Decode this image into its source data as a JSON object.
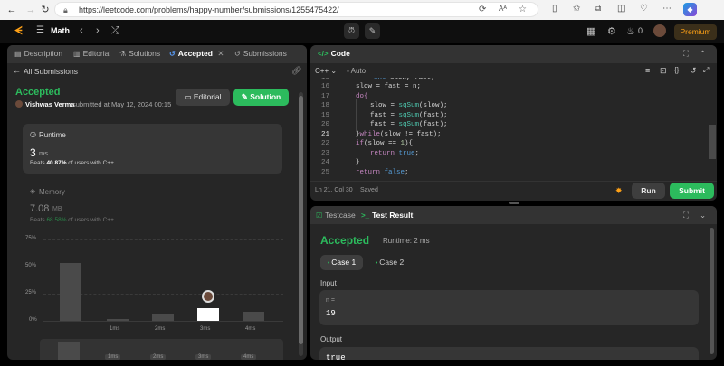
{
  "browser": {
    "url": "https://leetcode.com/problems/happy-number/submissions/1255475422/"
  },
  "topbar": {
    "problem_list": "Math",
    "points": "0",
    "premium": "Premium"
  },
  "left": {
    "tabs": [
      "Description",
      "Editorial",
      "Solutions",
      "Accepted",
      "Submissions"
    ],
    "all_submissions": "All Submissions",
    "status": "Accepted",
    "author": "Vishwas Verma",
    "submitted_text": "submitted at May 12, 2024 00:15",
    "editorial_btn": "Editorial",
    "solution_btn": "Solution",
    "runtime": {
      "label": "Runtime",
      "value": "3",
      "unit": "ms",
      "beats_prefix": "Beats",
      "beats_pct": "40.87%",
      "beats_suffix": "of users with C++"
    },
    "memory": {
      "label": "Memory",
      "value": "7.08",
      "unit": "MB",
      "beats_prefix": "Beats",
      "beats_pct": "68.58%",
      "beats_suffix": "of users with C++"
    },
    "chart": {
      "y_ticks": [
        "75%",
        "50%",
        "25%",
        "0%"
      ],
      "x_ticks": [
        "1ms",
        "2ms",
        "3ms",
        "4ms"
      ],
      "values_pct": [
        53,
        2,
        6,
        12,
        8
      ],
      "highlight_index": 3
    },
    "mini_x_ticks": [
      "1ms",
      "2ms",
      "3ms",
      "4ms"
    ]
  },
  "code": {
    "title": "Code",
    "language": "C++",
    "autosave": "Auto",
    "lines": [
      {
        "n": "15",
        "t": "int slow, fast;"
      },
      {
        "n": "16",
        "t": "slow = fast = n;"
      },
      {
        "n": "17",
        "t": "do{"
      },
      {
        "n": "18",
        "t": "slow = sqSum(slow);"
      },
      {
        "n": "19",
        "t": "fast = sqSum(fast);"
      },
      {
        "n": "20",
        "t": "fast = sqSum(fast);"
      },
      {
        "n": "21",
        "t": "}while(slow != fast);"
      },
      {
        "n": "22",
        "t": "if(slow == 1){"
      },
      {
        "n": "23",
        "t": "return true;"
      },
      {
        "n": "24",
        "t": "}"
      },
      {
        "n": "25",
        "t": "return false;"
      }
    ],
    "cursor": "Ln 21, Col 30",
    "saved": "Saved",
    "run": "Run",
    "submit": "Submit"
  },
  "test": {
    "tab_testcase": "Testcase",
    "tab_result": "Test Result",
    "status": "Accepted",
    "runtime": "Runtime: 2 ms",
    "cases": [
      "Case 1",
      "Case 2"
    ],
    "input_label": "Input",
    "input_var": "n =",
    "input_value": "19",
    "output_label": "Output",
    "output_value": "true"
  },
  "colors": {
    "accepted_green": "#2cbb5d",
    "accent_orange": "#ffa116",
    "panel_bg": "#262626",
    "tab_bg": "#333333"
  }
}
